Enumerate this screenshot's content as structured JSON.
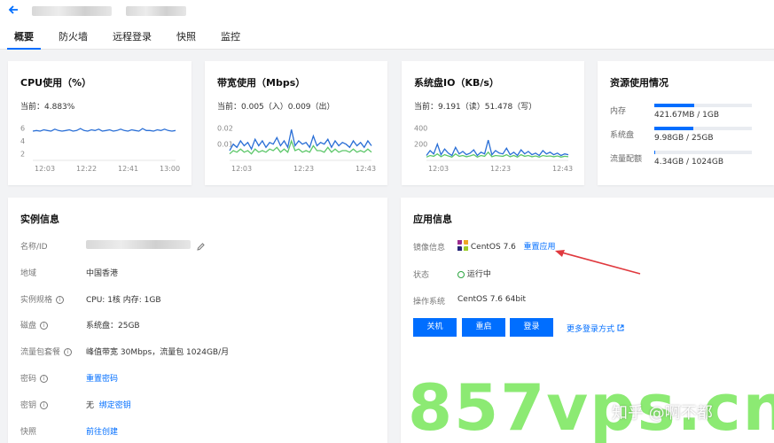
{
  "header": {
    "tabs": [
      {
        "label": "概要",
        "active": true
      },
      {
        "label": "防火墙"
      },
      {
        "label": "远程登录"
      },
      {
        "label": "快照"
      },
      {
        "label": "监控"
      }
    ]
  },
  "cpu": {
    "title": "CPU使用（%）",
    "current": "当前：4.883%",
    "chart_data": {
      "type": "line",
      "y_ticks": [
        "6",
        "4",
        "2"
      ],
      "ylim": [
        1,
        7
      ],
      "x_ticks": [
        "12:03",
        "12:22",
        "12:41",
        "13:00"
      ],
      "series": [
        {
          "color": "#2a6fd6",
          "values": [
            5.5,
            5.6,
            5.5,
            5.7,
            5.6,
            5.5,
            5.8,
            5.6,
            5.5,
            5.6,
            5.7,
            5.5,
            5.6,
            5.9,
            5.6,
            5.5,
            5.7,
            5.6,
            5.8,
            5.5,
            5.6,
            5.7,
            5.5,
            5.6,
            5.8,
            5.6,
            5.5,
            5.7,
            5.6,
            5.5,
            5.9,
            5.6,
            5.6,
            5.5,
            5.7,
            5.6,
            5.8,
            5.6,
            5.5,
            5.6
          ]
        }
      ]
    }
  },
  "bandwidth": {
    "title": "带宽使用（Mbps）",
    "current": "当前：0.005（入）0.009（出）",
    "chart_data": {
      "type": "line",
      "y_ticks": [
        "0.02",
        "0.01"
      ],
      "ylim": [
        0,
        0.024
      ],
      "x_ticks": [
        "12:03",
        "12:23",
        "12:43"
      ],
      "series": [
        {
          "color": "#2a6fd6",
          "values": [
            0.006,
            0.01,
            0.008,
            0.012,
            0.009,
            0.011,
            0.007,
            0.013,
            0.009,
            0.012,
            0.008,
            0.011,
            0.01,
            0.014,
            0.009,
            0.012,
            0.008,
            0.019,
            0.009,
            0.012,
            0.01,
            0.011,
            0.008,
            0.015,
            0.009,
            0.011,
            0.01,
            0.013,
            0.008,
            0.012,
            0.009,
            0.011,
            0.01,
            0.008,
            0.012,
            0.009,
            0.011,
            0.008,
            0.012,
            0.009
          ]
        },
        {
          "color": "#5dc76a",
          "values": [
            0.004,
            0.006,
            0.005,
            0.007,
            0.005,
            0.006,
            0.004,
            0.007,
            0.005,
            0.006,
            0.005,
            0.007,
            0.006,
            0.008,
            0.005,
            0.007,
            0.005,
            0.012,
            0.006,
            0.007,
            0.005,
            0.006,
            0.005,
            0.009,
            0.006,
            0.006,
            0.005,
            0.008,
            0.005,
            0.007,
            0.005,
            0.006,
            0.006,
            0.005,
            0.007,
            0.005,
            0.006,
            0.005,
            0.007,
            0.005
          ]
        }
      ]
    }
  },
  "disk_io": {
    "title": "系统盘IO（KB/s）",
    "current": "当前：9.191（读）51.478（写）",
    "chart_data": {
      "type": "line",
      "y_ticks": [
        "400",
        "200"
      ],
      "ylim": [
        0,
        480
      ],
      "x_ticks": [
        "12:03",
        "12:23",
        "12:43"
      ],
      "series": [
        {
          "color": "#2a6fd6",
          "values": [
            60,
            120,
            80,
            200,
            70,
            140,
            90,
            60,
            160,
            80,
            110,
            70,
            90,
            130,
            60,
            100,
            80,
            250,
            70,
            120,
            90,
            80,
            150,
            70,
            100,
            60,
            130,
            80,
            110,
            70,
            90,
            60,
            120,
            80,
            100,
            70,
            90,
            60,
            80,
            70
          ]
        },
        {
          "color": "#5dc76a",
          "values": [
            40,
            60,
            50,
            80,
            45,
            70,
            55,
            40,
            80,
            50,
            60,
            45,
            55,
            70,
            40,
            60,
            50,
            100,
            45,
            60,
            55,
            50,
            70,
            45,
            60,
            40,
            70,
            50,
            60,
            45,
            55,
            40,
            60,
            50,
            55,
            45,
            55,
            40,
            50,
            45
          ]
        }
      ]
    }
  },
  "resources": {
    "title": "资源使用情况",
    "items": [
      {
        "label": "内存",
        "value": "421.67MB / 1GB",
        "fill": 0.41
      },
      {
        "label": "系统盘",
        "value": "9.98GB / 25GB",
        "fill": 0.4
      },
      {
        "label": "流量配额",
        "value": "4.34GB / 1024GB",
        "fill": 0.005
      }
    ]
  },
  "instance": {
    "title": "实例信息",
    "rows": [
      {
        "label": "名称/ID",
        "value": ""
      },
      {
        "label": "地域",
        "value": "中国香港"
      },
      {
        "label": "实例规格",
        "value": "CPU: 1核 内存: 1GB"
      },
      {
        "label": "磁盘",
        "value": "系统盘：25GB"
      },
      {
        "label": "流量包套餐",
        "value": "峰值带宽 30Mbps，流量包 1024GB/月"
      },
      {
        "label": "密码",
        "link": "重置密码"
      },
      {
        "label": "密钥",
        "value": "无",
        "link": "绑定密钥"
      },
      {
        "label": "快照",
        "link": "前往创建"
      }
    ]
  },
  "app": {
    "title": "应用信息",
    "image_label": "镜像信息",
    "image_value": "CentOS 7.6",
    "image_link": "重置应用",
    "status_label": "状态",
    "status_value": "运行中",
    "os_label": "操作系统",
    "os_value": "CentOS 7.6 64bit",
    "buttons": {
      "shutdown": "关机",
      "restart": "重启",
      "login": "登录"
    },
    "more_login": "更多登录方式"
  },
  "overlay": {
    "watermark": "857vps.cn",
    "zhihu": "知乎 @啊不都"
  },
  "colors": {
    "accent": "#006eff",
    "status_ok": "#2da641",
    "arrow": "#e0393e"
  }
}
